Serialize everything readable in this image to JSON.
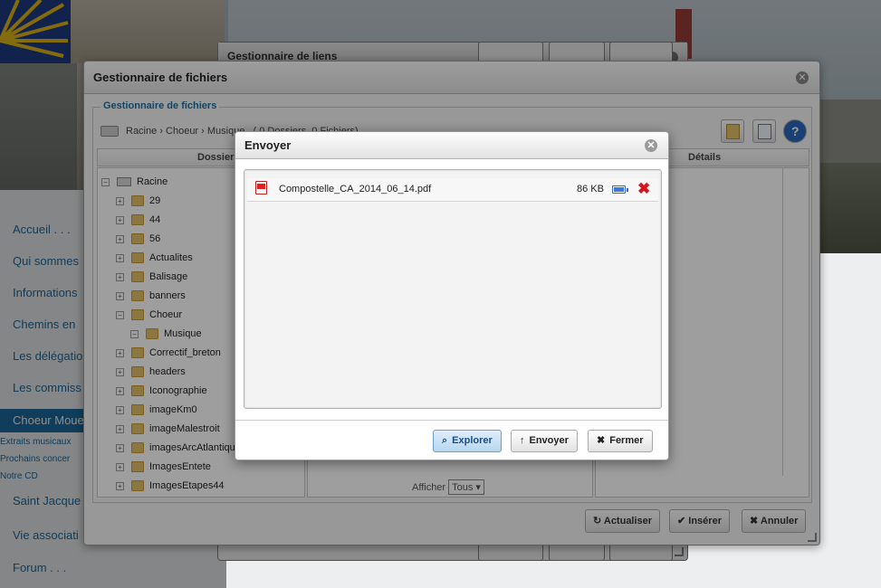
{
  "site": {
    "nav": [
      "Accueil . . .",
      "Qui sommes",
      "Informations",
      "Chemins en",
      "Les délégatio",
      "Les commiss",
      "Choeur Moue",
      "Saint Jacque",
      "Vie associati",
      "Forum . . ."
    ],
    "subnav": [
      "Extraits musicaux",
      "Prochains concer",
      "Notre CD"
    ],
    "link_dialog_title": "Gestionnaire de liens"
  },
  "filemanager": {
    "title": "Gestionnaire de fichiers",
    "legend": "Gestionnaire de fichiers",
    "path": "Racine › Choeur › Musique",
    "path_counts": "( 0 Dossiers, 0 Fichiers)",
    "col_folders": "Dossiers",
    "col_details": "Détails",
    "tree": {
      "root": "Racine",
      "folders": [
        "29",
        "44",
        "56",
        "Actualites",
        "Balisage",
        "banners",
        "Choeur",
        "Musique",
        "Correctif_breton",
        "headers",
        "Iconographie",
        "imageKm0",
        "imageMalestroit",
        "imagesArcAtlantique",
        "ImagesEntete",
        "ImagesEtapes44"
      ]
    },
    "show_label": "Afficher",
    "show_value": "Tous",
    "btn_refresh": "Actualiser",
    "btn_insert": "Insérer",
    "btn_cancel": "Annuler"
  },
  "upload": {
    "title": "Envoyer",
    "file": {
      "name": "Compostelle_CA_2014_06_14.pdf",
      "size": "86 KB",
      "progress": 1.0
    },
    "btn_browse": "Explorer",
    "btn_send": "Envoyer",
    "btn_close": "Fermer"
  },
  "icons": {
    "browse": "search-icon",
    "send": "upload-arrow-icon",
    "close": "x-icon",
    "refresh": "refresh-icon",
    "insert": "checkmark-icon"
  },
  "colors": {
    "accent": "#1b6fa5",
    "delete": "#d3161b",
    "primary_button": "#b8d6ef"
  }
}
